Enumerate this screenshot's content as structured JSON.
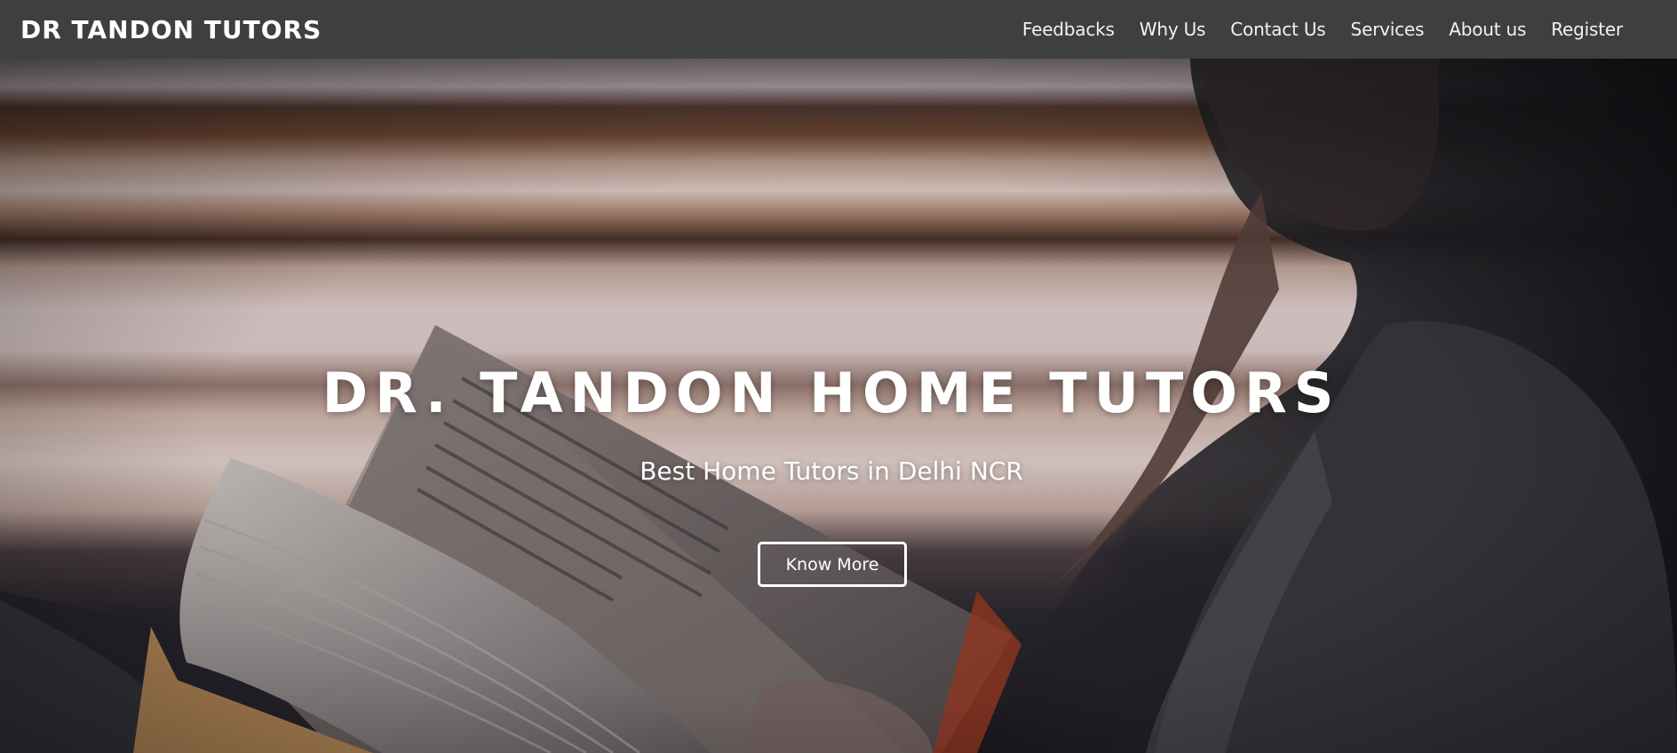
{
  "navbar": {
    "brand": "DR TANDON TUTORS",
    "links": [
      {
        "label": "Feedbacks"
      },
      {
        "label": "Why Us"
      },
      {
        "label": "Contact Us"
      },
      {
        "label": "Services"
      },
      {
        "label": "About us"
      },
      {
        "label": "Register"
      }
    ]
  },
  "hero": {
    "title": "DR. TANDON HOME TUTORS",
    "subtitle": "Best Home Tutors in Delhi NCR",
    "cta_label": "Know More"
  },
  "colors": {
    "navbar_bg": "#3f3f3f",
    "text": "#ffffff"
  }
}
